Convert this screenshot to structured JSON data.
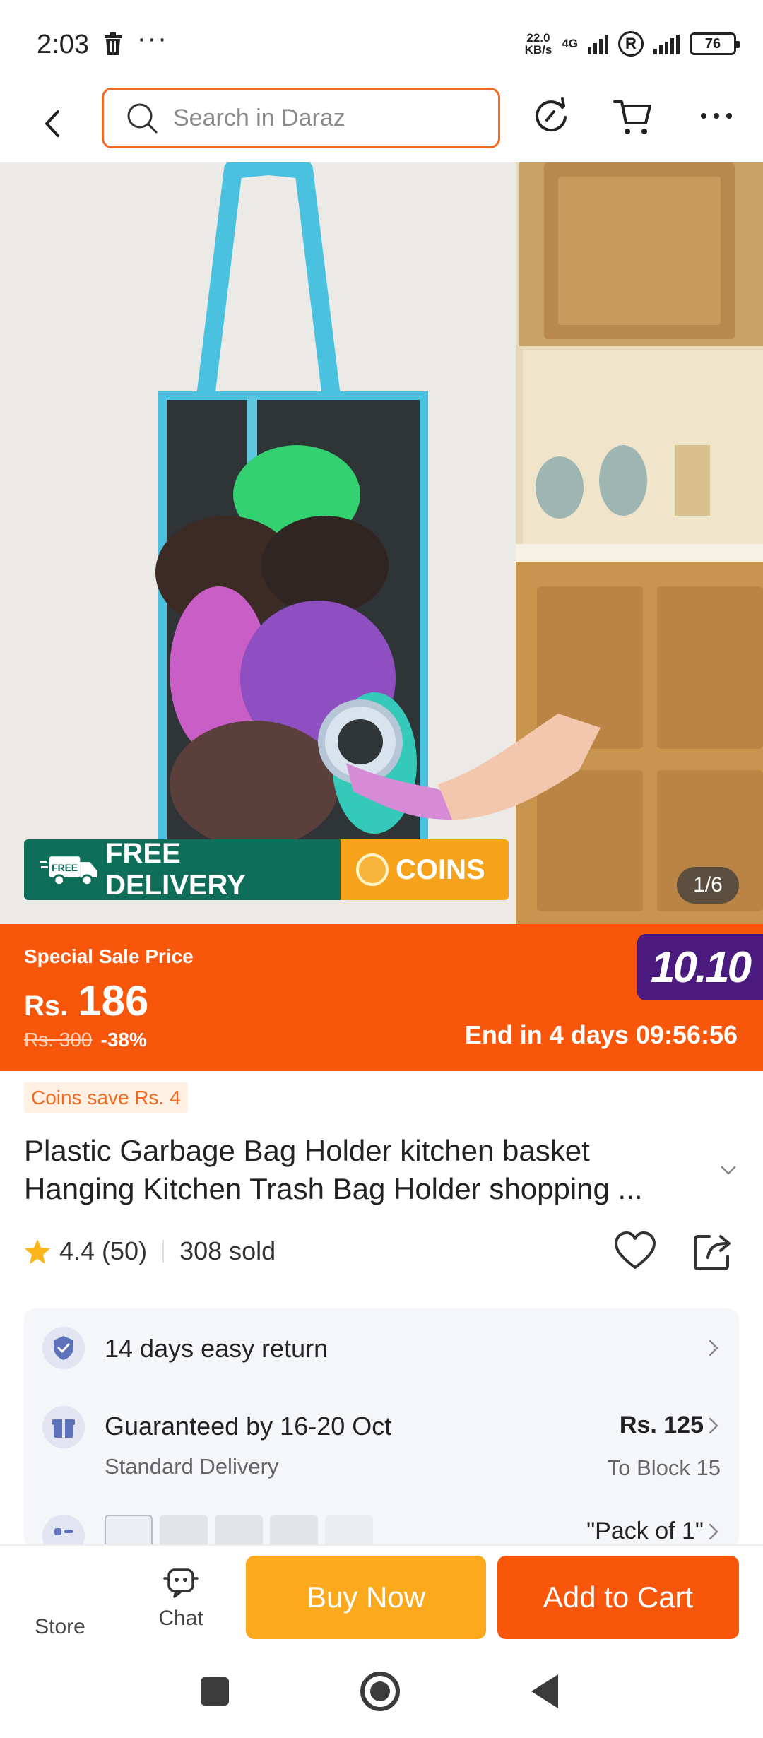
{
  "status_bar": {
    "time": "2:03",
    "net_speed_value": "22.0",
    "net_speed_unit": "KB/s",
    "network_type": "4G",
    "battery": "76"
  },
  "topnav": {
    "search_placeholder": "Search in Daraz"
  },
  "gallery": {
    "counter": "1/6",
    "promo_free_delivery": "FREE DELIVERY",
    "promo_free_badge": "FREE",
    "promo_coins": "COINS"
  },
  "price": {
    "sale_label": "Special Sale Price",
    "currency": "Rs.",
    "value": "186",
    "old_price": "Rs. 300",
    "discount": "-38%",
    "event_badge": "10.10",
    "countdown": "End in 4 days 09:56:56"
  },
  "coins_tag": "Coins save Rs. 4",
  "product": {
    "title": "Plastic Garbage Bag Holder kitchen basket Hanging Kitchen Trash Bag Holder shopping ...",
    "rating": "4.4",
    "reviews": "(50)",
    "sold": "308 sold"
  },
  "info": {
    "return_text": "14 days easy return",
    "delivery_text": "Guaranteed by 16-20 Oct",
    "delivery_sub": "Standard Delivery",
    "delivery_price": "Rs. 125",
    "delivery_location": "To Block 15",
    "variant_label": "\"Pack of 1\""
  },
  "bottom_bar": {
    "store": "Store",
    "chat": "Chat",
    "buy_now": "Buy Now",
    "add_to_cart": "Add to Cart"
  },
  "colors": {
    "accent_orange": "#f7560b",
    "buy_now_yellow": "#fca91d",
    "free_delivery_green": "#0f6e5a",
    "coins_amber": "#f7a21b",
    "event_purple": "#4a1a7f"
  },
  "icons": [
    "back-icon",
    "search-icon",
    "refresh-icon",
    "cart-icon",
    "more-icon",
    "star-icon",
    "heart-icon",
    "share-icon",
    "shield-check-icon",
    "gift-box-icon",
    "variant-icon",
    "chevron-right-icon",
    "store-icon",
    "chat-icon"
  ]
}
